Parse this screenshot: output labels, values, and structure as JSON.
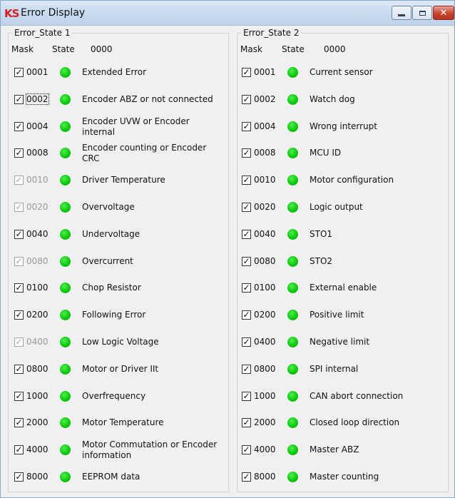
{
  "window": {
    "title": "Error Display",
    "icon_text": "KS",
    "buttons": {
      "minimize": "minimize-icon",
      "maximize": "maximize-icon",
      "close": "✕"
    }
  },
  "group1": {
    "title": "Error_State 1",
    "mask_header": "Mask",
    "state_header": "State",
    "value": "0000",
    "rows": [
      {
        "code": "0001",
        "label": "Extended Error",
        "checked": true,
        "disabled": false
      },
      {
        "code": "0002",
        "label": "Encoder ABZ or not connected",
        "checked": true,
        "disabled": false,
        "focus": true
      },
      {
        "code": "0004",
        "label": "Encoder UVW or Encoder internal",
        "checked": true,
        "disabled": false
      },
      {
        "code": "0008",
        "label": "Encoder counting or Encoder CRC",
        "checked": true,
        "disabled": false
      },
      {
        "code": "0010",
        "label": "Driver Temperature",
        "checked": true,
        "disabled": true
      },
      {
        "code": "0020",
        "label": "Overvoltage",
        "checked": true,
        "disabled": true
      },
      {
        "code": "0040",
        "label": "Undervoltage",
        "checked": true,
        "disabled": false
      },
      {
        "code": "0080",
        "label": "Overcurrent",
        "checked": true,
        "disabled": true
      },
      {
        "code": "0100",
        "label": "Chop Resistor",
        "checked": true,
        "disabled": false
      },
      {
        "code": "0200",
        "label": "Following Error",
        "checked": true,
        "disabled": false
      },
      {
        "code": "0400",
        "label": "Low Logic Voltage",
        "checked": true,
        "disabled": true
      },
      {
        "code": "0800",
        "label": "Motor or Driver IIt",
        "checked": true,
        "disabled": false
      },
      {
        "code": "1000",
        "label": "Overfrequency",
        "checked": true,
        "disabled": false
      },
      {
        "code": "2000",
        "label": "Motor Temperature",
        "checked": true,
        "disabled": false
      },
      {
        "code": "4000",
        "label": "Motor Commutation or Encoder information",
        "checked": true,
        "disabled": false
      },
      {
        "code": "8000",
        "label": "EEPROM data",
        "checked": true,
        "disabled": false
      }
    ]
  },
  "group2": {
    "title": "Error_State 2",
    "mask_header": "Mask",
    "state_header": "State",
    "value": "0000",
    "rows": [
      {
        "code": "0001",
        "label": "Current sensor",
        "checked": true,
        "disabled": false
      },
      {
        "code": "0002",
        "label": "Watch dog",
        "checked": true,
        "disabled": false
      },
      {
        "code": "0004",
        "label": "Wrong interrupt",
        "checked": true,
        "disabled": false
      },
      {
        "code": "0008",
        "label": "MCU ID",
        "checked": true,
        "disabled": false
      },
      {
        "code": "0010",
        "label": "Motor configuration",
        "checked": true,
        "disabled": false
      },
      {
        "code": "0020",
        "label": "Logic output",
        "checked": true,
        "disabled": false
      },
      {
        "code": "0040",
        "label": "STO1",
        "checked": true,
        "disabled": false
      },
      {
        "code": "0080",
        "label": "STO2",
        "checked": true,
        "disabled": false
      },
      {
        "code": "0100",
        "label": "External enable",
        "checked": true,
        "disabled": false
      },
      {
        "code": "0200",
        "label": "Positive limit",
        "checked": true,
        "disabled": false
      },
      {
        "code": "0400",
        "label": "Negative limit",
        "checked": true,
        "disabled": false
      },
      {
        "code": "0800",
        "label": "SPI internal",
        "checked": true,
        "disabled": false
      },
      {
        "code": "1000",
        "label": "CAN abort connection",
        "checked": true,
        "disabled": false
      },
      {
        "code": "2000",
        "label": "Closed loop direction",
        "checked": true,
        "disabled": false
      },
      {
        "code": "4000",
        "label": "Master ABZ",
        "checked": true,
        "disabled": false
      },
      {
        "code": "8000",
        "label": "Master counting",
        "checked": true,
        "disabled": false
      }
    ]
  },
  "colors": {
    "led_ok": "#0bc40b",
    "disabled_text": "#9a9a9a"
  }
}
